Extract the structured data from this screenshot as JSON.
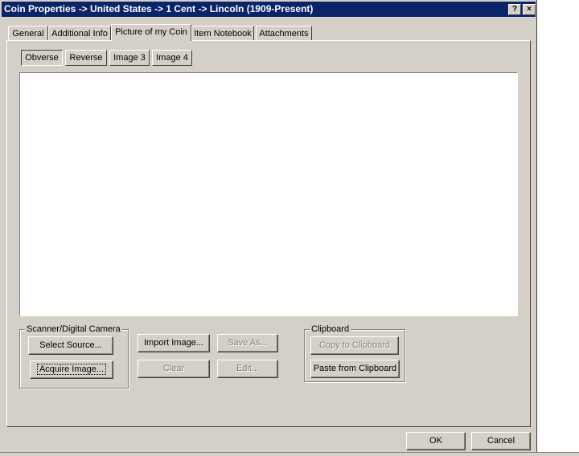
{
  "window": {
    "title": "Coin Properties -> United States -> 1 Cent -> Lincoln (1909-Present)",
    "help_label": "?",
    "close_label": "×"
  },
  "tabs": [
    {
      "label": "General"
    },
    {
      "label": "Additional Info"
    },
    {
      "label": "Picture of my Coin",
      "active": true
    },
    {
      "label": "Item Notebook"
    },
    {
      "label": "Attachments"
    }
  ],
  "image_tabs": [
    {
      "label": "Obverse",
      "selected": true
    },
    {
      "label": "Reverse"
    },
    {
      "label": "Image 3"
    },
    {
      "label": "Image 4"
    }
  ],
  "scanner_group": {
    "label": "Scanner/Digital Camera",
    "select_source": "Select Source...",
    "acquire_image": "Acquire Image..."
  },
  "actions": {
    "import_image": "Import Image...",
    "save_as": "Save As...",
    "clear": "Clear",
    "edit": "Edit..."
  },
  "clipboard_group": {
    "label": "Clipboard",
    "copy": "Copy to Clipboard",
    "paste": "Paste from Clipboard"
  },
  "footer": {
    "ok": "OK",
    "cancel": "Cancel"
  }
}
